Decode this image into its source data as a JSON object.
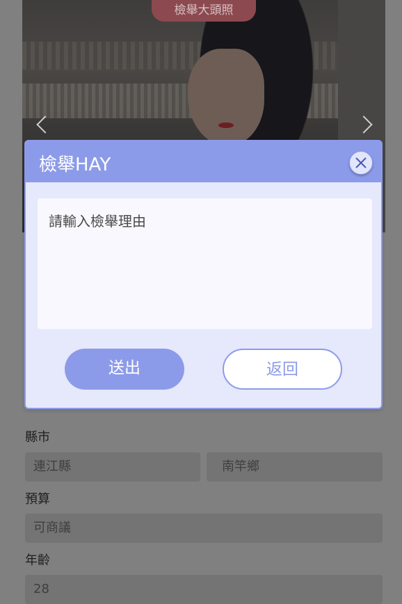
{
  "photo": {
    "badge": "檢舉大頭照"
  },
  "form": {
    "city_label": "縣市",
    "city_value": "連江縣",
    "district_value": "南竿鄉",
    "budget_label": "預算",
    "budget_value": "可商議",
    "age_label": "年齡",
    "age_value": "28"
  },
  "dialog": {
    "title": "檢舉HAY",
    "reason_placeholder": "請輸入檢舉理由",
    "submit_label": "送出",
    "back_label": "返回"
  },
  "colors": {
    "accent": "#8c9be9",
    "dialog_bg": "#e6e8fb",
    "overlay": "#808080",
    "badge": "#8c4a50"
  }
}
